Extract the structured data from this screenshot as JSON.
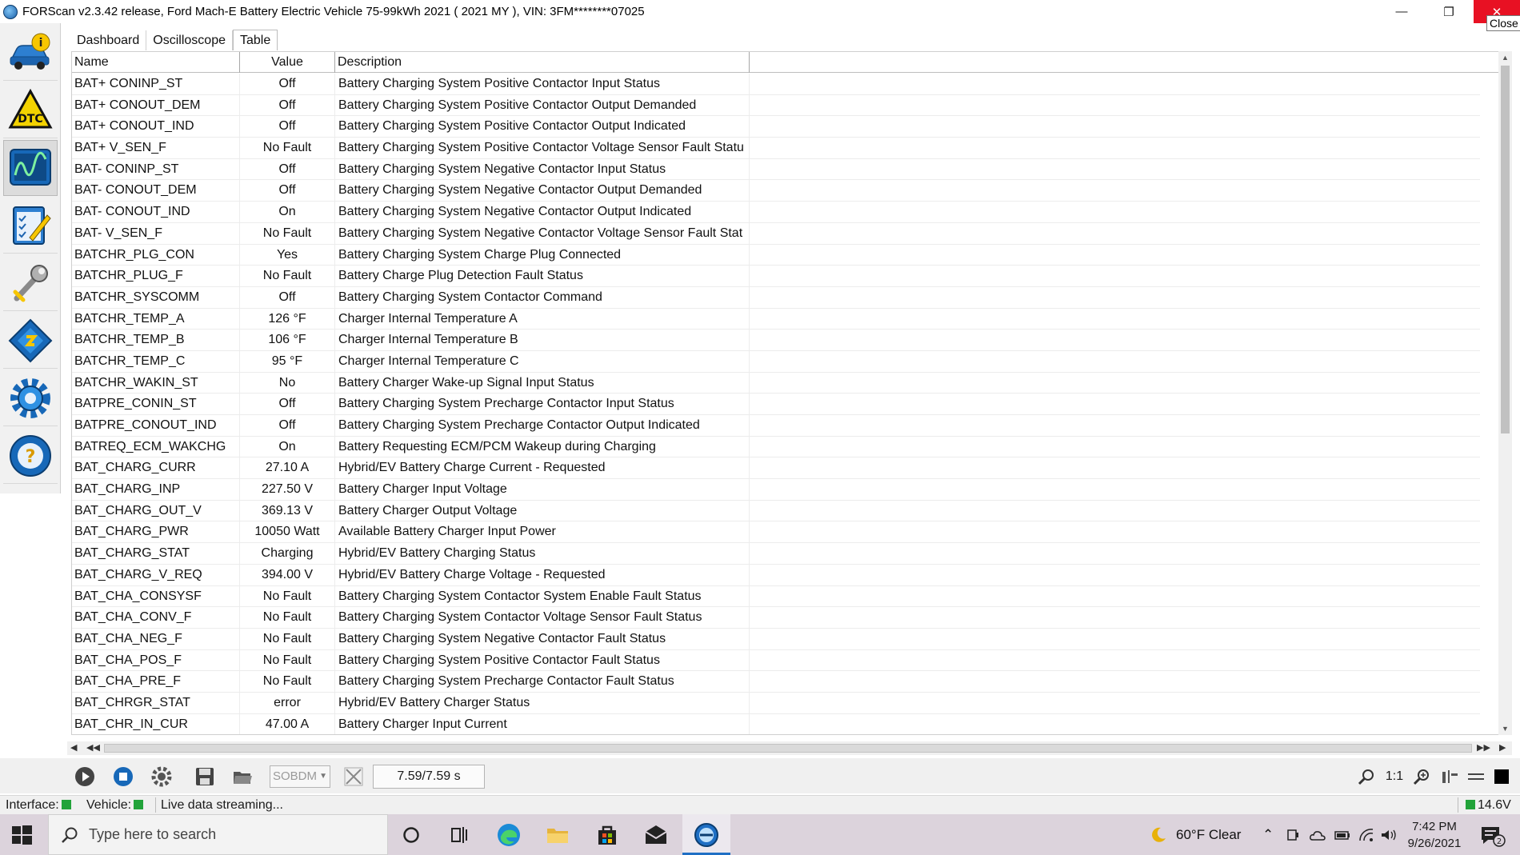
{
  "window": {
    "title": "FORScan v2.3.42 release, Ford Mach-E Battery Electric Vehicle 75-99kWh 2021 ( 2021 MY ), VIN: 3FM********07025",
    "min_glyph": "—",
    "max_glyph": "❐",
    "close_glyph": "✕",
    "close_tooltip": "Close"
  },
  "sidebar": {
    "items": [
      {
        "name": "vehicle-info-icon",
        "active": false
      },
      {
        "name": "dtc-icon",
        "active": false
      },
      {
        "name": "oscilloscope-icon",
        "active": true
      },
      {
        "name": "tests-checklist-icon",
        "active": false
      },
      {
        "name": "service-wrench-icon",
        "active": false
      },
      {
        "name": "configuration-chip-icon",
        "active": false
      },
      {
        "name": "settings-gear-icon",
        "active": false
      },
      {
        "name": "help-icon",
        "active": false
      }
    ],
    "dtc_label": "DTC"
  },
  "tabs": [
    {
      "label": "Dashboard",
      "active": false
    },
    {
      "label": "Oscilloscope",
      "active": false
    },
    {
      "label": "Table",
      "active": true
    }
  ],
  "table": {
    "columns": {
      "name": "Name",
      "value": "Value",
      "description": "Description"
    },
    "rows": [
      {
        "name": "BAT+ CONINP_ST",
        "value": "Off",
        "desc": "Battery Charging System Positive Contactor Input Status"
      },
      {
        "name": "BAT+ CONOUT_DEM",
        "value": "Off",
        "desc": "Battery Charging System Positive Contactor Output Demanded"
      },
      {
        "name": "BAT+ CONOUT_IND",
        "value": "Off",
        "desc": "Battery Charging System Positive Contactor Output Indicated"
      },
      {
        "name": "BAT+ V_SEN_F",
        "value": "No Fault",
        "desc": "Battery Charging System Positive Contactor Voltage Sensor Fault Statu"
      },
      {
        "name": "BAT- CONINP_ST",
        "value": "Off",
        "desc": "Battery Charging System Negative Contactor Input Status"
      },
      {
        "name": "BAT- CONOUT_DEM",
        "value": "Off",
        "desc": "Battery Charging System Negative Contactor Output Demanded"
      },
      {
        "name": "BAT- CONOUT_IND",
        "value": "On",
        "desc": "Battery Charging System Negative Contactor Output Indicated"
      },
      {
        "name": "BAT- V_SEN_F",
        "value": "No Fault",
        "desc": "Battery Charging System Negative Contactor Voltage Sensor Fault Stat"
      },
      {
        "name": "BATCHR_PLG_CON",
        "value": "Yes",
        "desc": "Battery Charging System Charge Plug Connected"
      },
      {
        "name": "BATCHR_PLUG_F",
        "value": "No Fault",
        "desc": "Battery Charge Plug Detection Fault Status"
      },
      {
        "name": "BATCHR_SYSCOMM",
        "value": "Off",
        "desc": "Battery Charging System Contactor Command"
      },
      {
        "name": "BATCHR_TEMP_A",
        "value": "126 °F",
        "desc": "Charger Internal Temperature A"
      },
      {
        "name": "BATCHR_TEMP_B",
        "value": "106 °F",
        "desc": "Charger Internal Temperature B"
      },
      {
        "name": "BATCHR_TEMP_C",
        "value": "95 °F",
        "desc": "Charger Internal Temperature C"
      },
      {
        "name": "BATCHR_WAKIN_ST",
        "value": "No",
        "desc": "Battery Charger Wake-up Signal Input Status"
      },
      {
        "name": "BATPRE_CONIN_ST",
        "value": "Off",
        "desc": "Battery Charging System Precharge Contactor Input Status"
      },
      {
        "name": "BATPRE_CONOUT_IND",
        "value": "Off",
        "desc": "Battery Charging System Precharge Contactor Output Indicated"
      },
      {
        "name": "BATREQ_ECM_WAKCHG",
        "value": "On",
        "desc": "Battery Requesting ECM/PCM Wakeup during Charging"
      },
      {
        "name": "BAT_CHARG_CURR",
        "value": "27.10 A",
        "desc": "Hybrid/EV Battery Charge Current - Requested"
      },
      {
        "name": "BAT_CHARG_INP",
        "value": "227.50 V",
        "desc": "Battery Charger Input Voltage"
      },
      {
        "name": "BAT_CHARG_OUT_V",
        "value": "369.13 V",
        "desc": "Battery Charger Output Voltage"
      },
      {
        "name": "BAT_CHARG_PWR",
        "value": "10050 Watt",
        "desc": "Available Battery Charger Input Power"
      },
      {
        "name": "BAT_CHARG_STAT",
        "value": "Charging",
        "desc": "Hybrid/EV Battery Charging Status"
      },
      {
        "name": "BAT_CHARG_V_REQ",
        "value": "394.00 V",
        "desc": "Hybrid/EV Battery Charge Voltage - Requested"
      },
      {
        "name": "BAT_CHA_CONSYSF",
        "value": "No Fault",
        "desc": "Battery Charging System Contactor System Enable Fault Status"
      },
      {
        "name": "BAT_CHA_CONV_F",
        "value": "No Fault",
        "desc": "Battery Charging System Contactor Voltage Sensor Fault Status"
      },
      {
        "name": "BAT_CHA_NEG_F",
        "value": "No Fault",
        "desc": "Battery Charging System Negative Contactor Fault Status"
      },
      {
        "name": "BAT_CHA_POS_F",
        "value": "No Fault",
        "desc": "Battery Charging System Positive Contactor Fault Status"
      },
      {
        "name": "BAT_CHA_PRE_F",
        "value": "No Fault",
        "desc": "Battery Charging System Precharge Contactor Fault Status"
      },
      {
        "name": "BAT_CHRGR_STAT",
        "value": "error",
        "desc": "Hybrid/EV Battery Charger Status"
      },
      {
        "name": "BAT_CHR_IN_CUR",
        "value": "47.00 A",
        "desc": "Battery Charger Input Current"
      }
    ]
  },
  "toolbar": {
    "protocol_select": "SOBDM",
    "time": "7.59/7.59 s",
    "zoom_ratio": "1:1"
  },
  "status": {
    "interface_label": "Interface:",
    "vehicle_label": "Vehicle:",
    "message": "Live data streaming...",
    "voltage": "14.6V",
    "led_color": "#22a33a"
  },
  "taskbar": {
    "search_placeholder": "Type here to search",
    "weather": "60°F  Clear",
    "time": "7:42 PM",
    "date": "9/26/2021",
    "notification_count": "2"
  }
}
